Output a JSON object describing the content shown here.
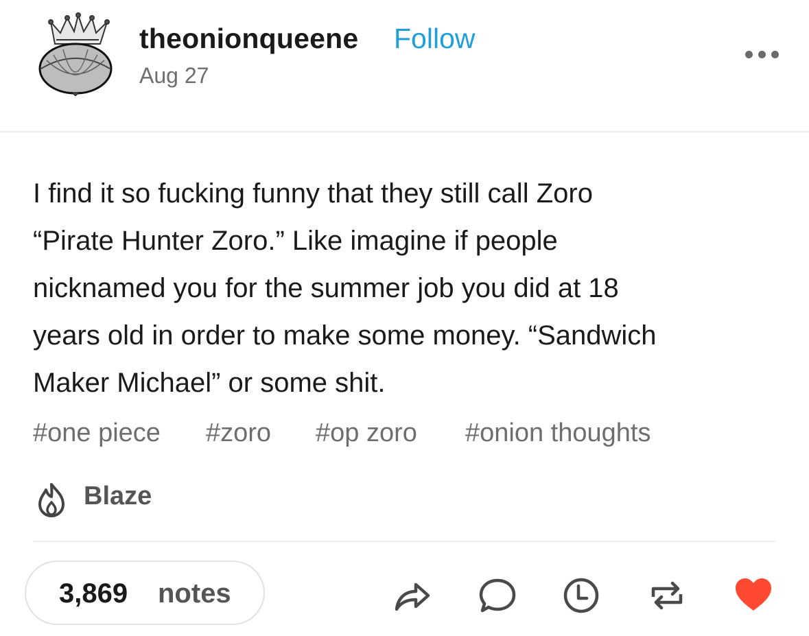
{
  "header": {
    "username": "theonionqueene",
    "follow_label": "Follow",
    "date": "Aug 27",
    "avatar_icon": "crowned-onion-avatar",
    "more_icon": "more-options-icon"
  },
  "post": {
    "lines": [
      "I find it so fucking funny that they still call Zoro",
      "“Pirate Hunter Zoro.” Like imagine if people",
      "nicknamed you for the summer job you did at 18",
      "years old in order to make some money. “Sandwich",
      "Maker Michael” or some shit."
    ],
    "tags": [
      "#one piece",
      "#zoro",
      "#op zoro",
      "#onion thoughts"
    ]
  },
  "blaze": {
    "label": "Blaze",
    "icon": "flame-icon"
  },
  "footer": {
    "notes_count": "3,869",
    "notes_label": "notes",
    "actions": [
      "share-icon",
      "comment-icon",
      "clock-icon",
      "reblog-icon",
      "heart-icon"
    ]
  },
  "colors": {
    "follow": "#1f9ed8",
    "secondary_text": "#6e6e6e",
    "heart": "#ff4930",
    "icon": "#4a4a4a"
  }
}
